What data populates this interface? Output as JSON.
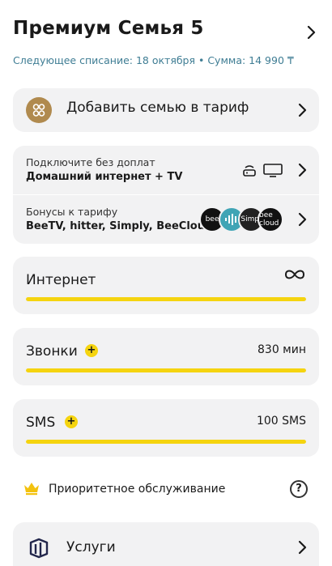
{
  "header": {
    "title": "Премиум Семья 5",
    "subtitle": "Следующее списание: 18 октября • Сумма: 14 990 ₸"
  },
  "add_family": {
    "label": "Добавить семью в тариф",
    "icon": "family-icon"
  },
  "connect_free": {
    "line1": "Подключите без доплат",
    "line2": "Домашний интернет + TV",
    "icons": [
      "router-icon",
      "tv-icon"
    ]
  },
  "bonuses": {
    "line1": "Бонусы к тарифу",
    "line2": "BeeTV, hitter, Simply, BeeCloud",
    "logos": [
      "bee",
      "",
      "Simpl",
      "bee cloud"
    ]
  },
  "internet": {
    "title": "Интернет",
    "fill_percent": 100
  },
  "calls": {
    "title": "Звонки",
    "value": "830 мин",
    "fill_percent": 100
  },
  "sms": {
    "title": "SMS",
    "value": "100 SMS",
    "fill_percent": 100
  },
  "priority": {
    "label": "Приоритетное обслуживание"
  },
  "services": {
    "label": "Услуги"
  },
  "colors": {
    "accent": "#f5d40f",
    "card": "#f2f2f3",
    "subtitle": "#3f7d94",
    "crown": "#f3c20f"
  }
}
